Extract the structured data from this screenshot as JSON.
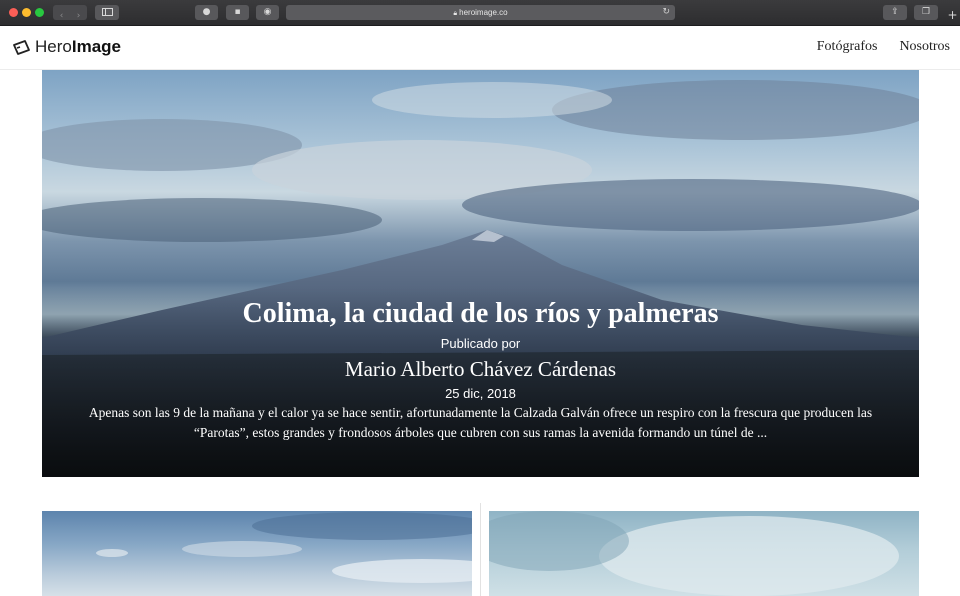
{
  "browser": {
    "url": "heroimage.co",
    "lock_icon": "lock-icon",
    "reload_icon": "reload-icon"
  },
  "site": {
    "logo_light": "Hero",
    "logo_bold": "Image",
    "nav": [
      {
        "label": "Fotógrafos"
      },
      {
        "label": "Nosotros"
      }
    ]
  },
  "hero": {
    "title": "Colima, la ciudad de los ríos y palmeras",
    "published_by": "Publicado por",
    "author": "Mario Alberto Chávez Cárdenas",
    "date": "25 dic, 2018",
    "excerpt": "Apenas son las 9 de la mañana y el calor ya se hace sentir, afortunadamente la Calzada Galván ofrece un respiro con la frescura que producen las “Parotas”, estos grandes y frondosos árboles que cubren con sus ramas la avenida formando un túnel de ..."
  },
  "colors": {
    "chrome_bg": "#2d2d2f",
    "accent_text": "#222222"
  }
}
